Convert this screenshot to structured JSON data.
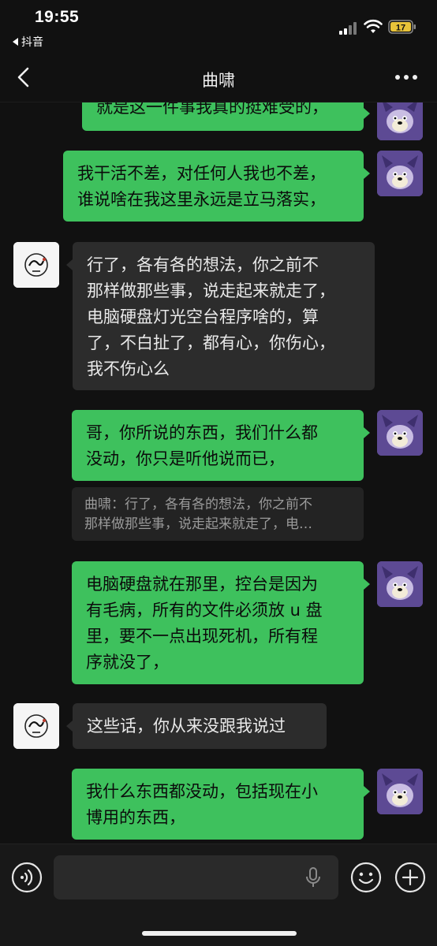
{
  "status_bar": {
    "time": "19:55",
    "back_app_label": "抖音",
    "battery_level": "17",
    "battery_color": "#e8c33a",
    "icons": [
      "signal-icon",
      "wifi-icon",
      "battery-icon"
    ]
  },
  "nav": {
    "title": "曲啸",
    "back_icon": "chevron-left-icon",
    "more_icon": "more-dots-icon"
  },
  "messages": [
    {
      "sender": "me",
      "text": "就是这一件事我真的挺难受的，"
    },
    {
      "sender": "me",
      "text": "我干活不差，对任何人我也不差，\n谁说啥在我这里永远是立马落实，"
    },
    {
      "sender": "them",
      "text": "行了，各有各的想法，你之前不\n那样做那些事，说走起来就走了，\n电脑硬盘灯光空台程序啥的，算\n了，不白扯了，都有心，你伤心，\n我不伤心么"
    },
    {
      "sender": "me",
      "text": "哥，你所说的东西，我们什么都\n没动，你只是听他说而已，"
    },
    {
      "sender": "me",
      "text": "电脑硬盘就在那里，控台是因为\n有毛病，所有的文件必须放 u 盘\n里，要不一点出现死机，所有程\n序就没了，"
    },
    {
      "sender": "them",
      "text": "这些话，你从来没跟我说过"
    },
    {
      "sender": "me",
      "text": "我什么东西都没动，包括现在小\n博用的东西，"
    }
  ],
  "quote": {
    "text": "曲啸：行了，各有各的想法，你之前不\n那样做那些事，说走起来就走了，电…"
  },
  "colors": {
    "my_bubble": "#3ec15d",
    "their_bubble": "#2c2c2c",
    "background": "#111111"
  },
  "input_bar": {
    "icons": [
      "voice-icon",
      "mic-icon",
      "emoji-icon",
      "plus-icon"
    ]
  }
}
